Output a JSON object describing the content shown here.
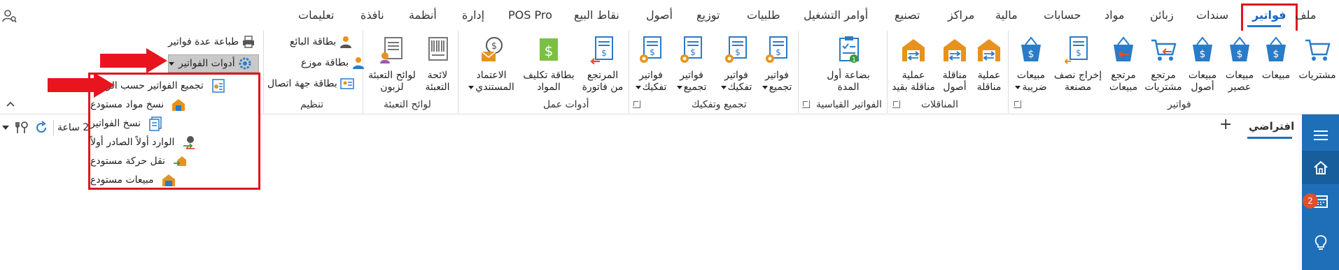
{
  "menubar": {
    "items": [
      "ملف",
      "فواتير",
      "سندات",
      "زبائن",
      "مواد",
      "حسابات",
      "مالية",
      "مراكز",
      "تصنيع",
      "أوامر التشغيل",
      "طلبيات",
      "توزيع",
      "أصول",
      "نقاط البيع",
      "POS Pro",
      "إدارة",
      "أنظمة",
      "نافذة",
      "تعليمات"
    ],
    "active": "فواتير"
  },
  "ribbon": {
    "invoices_group": {
      "label": "فواتير",
      "buttons": [
        {
          "l1": "مشتريات",
          "l2": ""
        },
        {
          "l1": "مبيعات",
          "l2": ""
        },
        {
          "l1": "مبيعات",
          "l2": "عصير"
        },
        {
          "l1": "مبيعات",
          "l2": "أصول"
        },
        {
          "l1": "مرتجع",
          "l2": "مشتريات"
        },
        {
          "l1": "مرتجع",
          "l2": "مبيعات"
        },
        {
          "l1": "إخراج نصف",
          "l2": "مصنعة"
        },
        {
          "l1": "مبيعات",
          "l2": "ضريبة"
        }
      ]
    },
    "transfers_group": {
      "label": "المناقلات",
      "buttons": [
        {
          "l1": "عملية",
          "l2": "مناقلة"
        },
        {
          "l1": "مناقلة",
          "l2": "أصول"
        },
        {
          "l1": "عملية",
          "l2": "مناقلة بقيد"
        }
      ]
    },
    "standard_group": {
      "label": "الفواتير القياسية",
      "buttons": [
        {
          "l1": "بضاعة أول",
          "l2": "المدة"
        }
      ]
    },
    "assembly_group": {
      "label": "تجميع وتفكيك",
      "buttons": [
        {
          "l1": "فواتير",
          "l2": "تجميع"
        },
        {
          "l1": "فواتير",
          "l2": "تفكيك"
        },
        {
          "l1": "فواتير",
          "l2": "تجميع"
        },
        {
          "l1": "فواتير",
          "l2": "تفكيك"
        }
      ]
    },
    "worktools_group": {
      "label": "أدوات عمل",
      "buttons": [
        {
          "l1": "المرتجع",
          "l2": "من فاتورة"
        },
        {
          "l1": "بطاقة تكليف",
          "l2": "المواد"
        },
        {
          "l1": "الاعتماد",
          "l2": "المستندي"
        }
      ]
    },
    "packing_group": {
      "label": "لوائح التعبئة",
      "buttons": [
        {
          "l1": "لائحة",
          "l2": "التعبئة"
        },
        {
          "l1": "لوائح التعبئة",
          "l2": "لزبون"
        }
      ]
    },
    "organize_group": {
      "label": "تنظيم",
      "items": [
        "بطاقة البائع",
        "بطاقة موزع",
        "بطاقة جهة اتصال"
      ]
    },
    "print_multi": "طباعة عدة فواتير",
    "tools_button": "أدوات الفواتير"
  },
  "dropdown": {
    "items": [
      "تجميع الفواتير حسب الزبائن",
      "نسخ مواد مستودع",
      "نسخ الفواتير",
      "الوارد أولاً الصادر أولاً",
      "نقل حركة مستودع",
      "مبيعات مستودع"
    ]
  },
  "doc": {
    "tab": "افتراضي",
    "hours_label": "2 ساعة",
    "badge_count": "2"
  },
  "colors": {
    "accent": "#1f6fb8",
    "highlight_red": "#e0141e",
    "icon_blue": "#2a7bc8",
    "icon_orange": "#e8921e"
  }
}
